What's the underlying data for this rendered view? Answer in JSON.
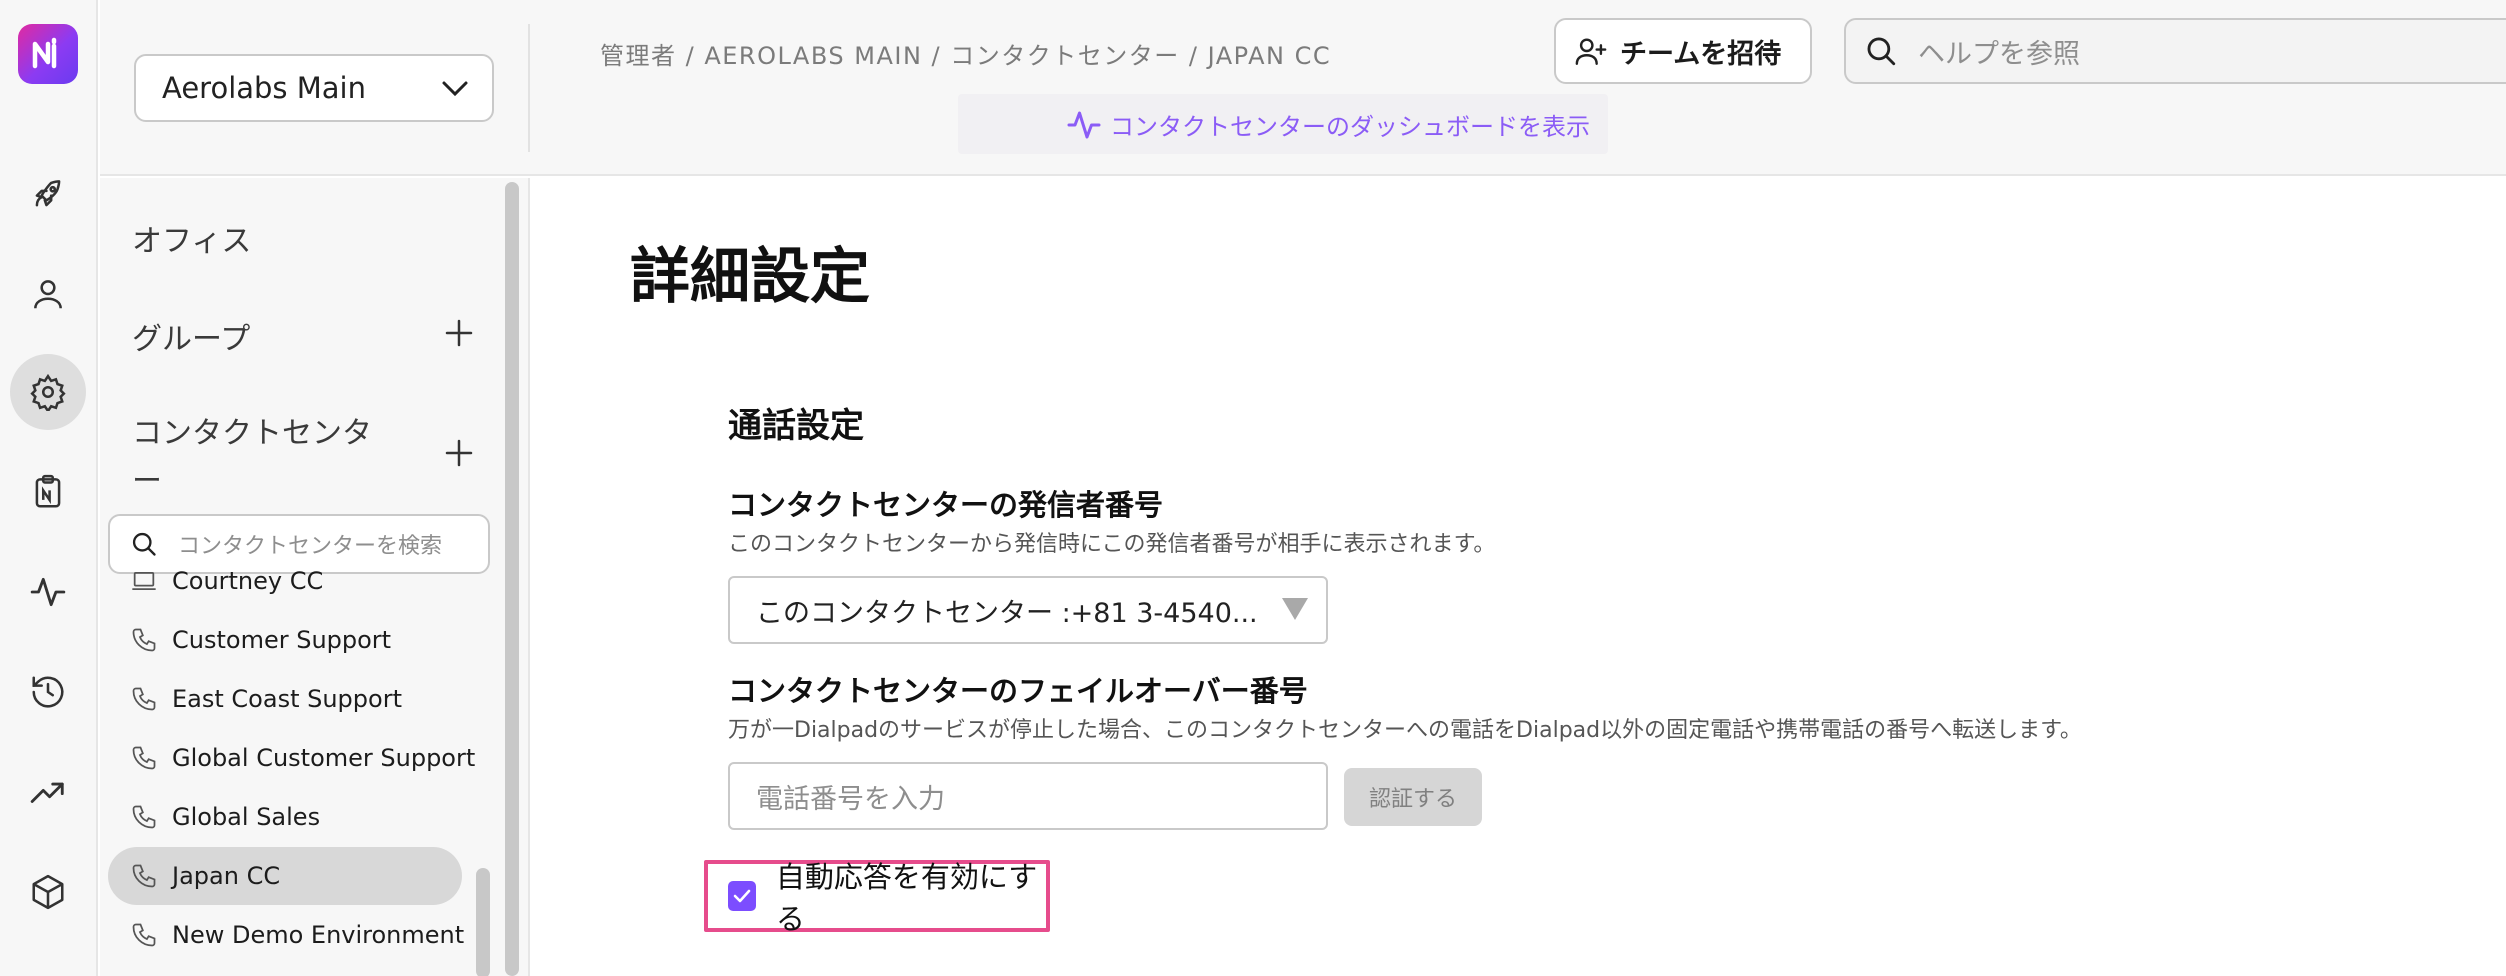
{
  "header": {
    "office_select": "Aerolabs Main",
    "breadcrumb": "管理者 / AEROLABS MAIN / コンタクトセンター / JAPAN CC",
    "dashboard_link": "コンタクトセンターのダッシュボードを表示",
    "invite_button": "チームを招待",
    "help_search_placeholder": "ヘルプを参照"
  },
  "rail": {
    "items": [
      "rocket-icon",
      "user-icon",
      "gear-icon",
      "clipboard-icon",
      "activity-icon",
      "history-icon",
      "trending-icon",
      "cube-icon"
    ],
    "active": "gear-icon",
    "accent": "#8b5cf6"
  },
  "sidebar": {
    "offices_label": "オフィス",
    "groups_label": "グループ",
    "contact_centers_label": "コンタクトセンター",
    "search_placeholder": "コンタクトセンターを検索",
    "items": [
      {
        "label": "Courtney CC",
        "icon": "laptop-icon"
      },
      {
        "label": "Customer Support",
        "icon": "phone-icon"
      },
      {
        "label": "East Coast Support",
        "icon": "phone-icon"
      },
      {
        "label": "Global Customer Support",
        "icon": "phone-icon"
      },
      {
        "label": "Global Sales",
        "icon": "phone-icon"
      },
      {
        "label": "Japan CC",
        "icon": "phone-icon"
      },
      {
        "label": "New Demo Environment",
        "icon": "phone-icon"
      }
    ],
    "selected": "Japan CC"
  },
  "main": {
    "page_title": "詳細設定",
    "section_title": "通話設定",
    "caller_id": {
      "label": "コンタクトセンターの発信者番号",
      "description": "このコンタクトセンターから発信時にこの発信者番号が相手に表示されます。",
      "value": "このコンタクトセンター :+81 3-4540..."
    },
    "failover": {
      "label": "コンタクトセンターのフェイルオーバー番号",
      "description": "万が一Dialpadのサービスが停止した場合、このコンタクトセンターへの電話をDialpad以外の固定電話や携帯電話の番号へ転送します。",
      "placeholder": "電話番号を入力",
      "verify_button": "認証する"
    },
    "auto_answer": {
      "label": "自動応答を有効にする",
      "checked": true,
      "highlight_color": "#e64c8c"
    }
  }
}
